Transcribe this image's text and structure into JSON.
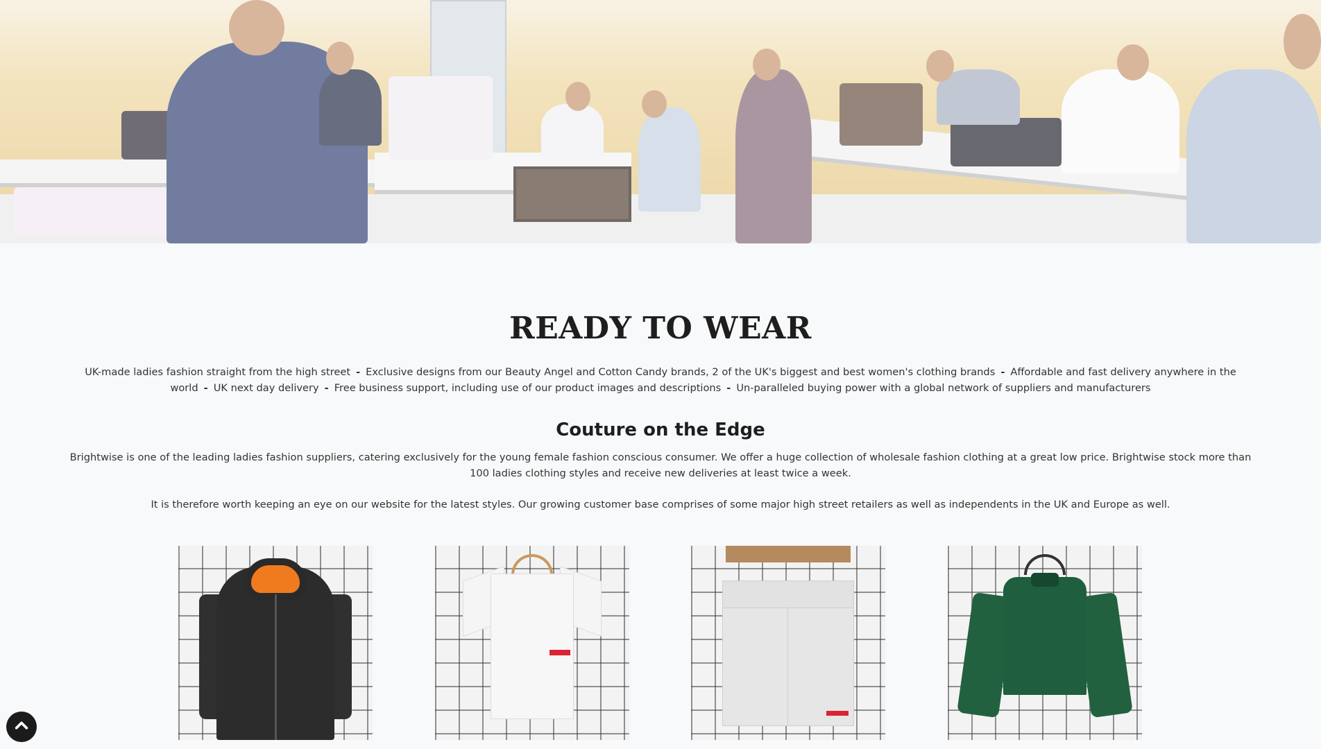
{
  "hero": {
    "image_description_icon": "factory-floor-photo"
  },
  "main": {
    "title": "READY TO WEAR",
    "features": [
      "UK-made ladies fashion straight from the high street",
      "Exclusive designs from our Beauty Angel and Cotton Candy brands, 2 of the UK's biggest and best women's clothing brands",
      "Affordable and fast delivery anywhere in the world",
      "UK next day delivery",
      "Free business support, including use of our product images and descriptions",
      "Un-paralleled buying power with a global network of suppliers and manufacturers"
    ],
    "separator": "-",
    "subtitle": "Couture on the Edge",
    "paragraph_1": "Brightwise is one of the leading ladies fashion suppliers, catering exclusively for the young female fashion conscious consumer. We offer a huge collection of wholesale fashion clothing at a great low price. Brightwise stock more than 100 ladies clothing styles and receive new deliveries at least twice a week.",
    "paragraph_2": "It is therefore worth keeping an eye on our website for the latest styles. Our growing customer base comprises of some major high street retailers as well as independents in the UK and Europe  as well."
  },
  "products": [
    {
      "icon": "black-hoodie-image"
    },
    {
      "icon": "white-tshirt-image"
    },
    {
      "icon": "grey-shorts-image"
    },
    {
      "icon": "green-sweatshirt-image"
    }
  ],
  "colors": {
    "page_background": "#f8f9fa",
    "back_to_top_background": "#1b1b1b"
  },
  "back_to_top": {
    "icon": "chevron-up-icon"
  }
}
